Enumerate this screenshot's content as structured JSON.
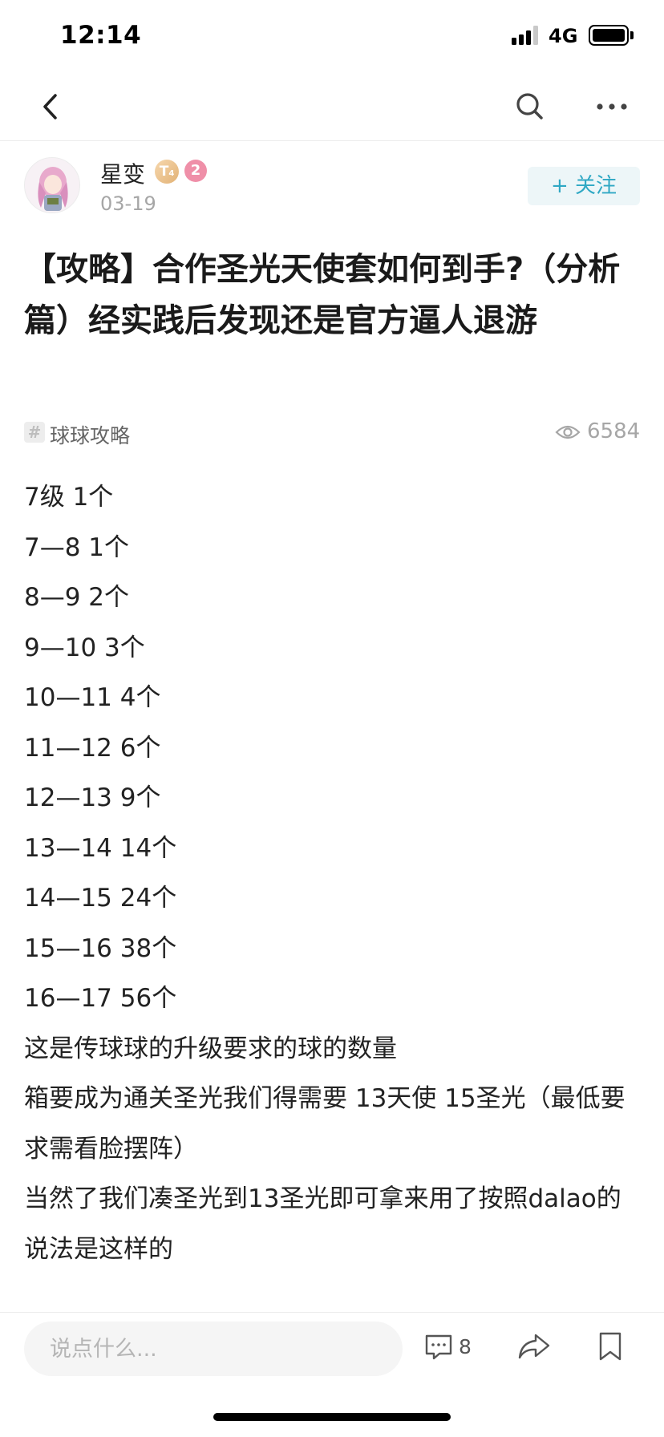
{
  "status_bar": {
    "time": "12:14",
    "network": "4G"
  },
  "nav": {
    "back_icon": "chevron-left-icon",
    "search_icon": "search-icon",
    "more_icon": "more-horizontal-icon"
  },
  "author": {
    "name": "星变",
    "badge_label": "T",
    "badge_sub": "4",
    "level": "2",
    "date": "03-19",
    "follow_label": "+ 关注"
  },
  "post": {
    "title": "【攻略】合作圣光天使套如何到手?（分析篇）经实践后发现还是官方逼人退游",
    "tag_label": "球球攻略",
    "view_count": "6584",
    "body_lines": [
      "7级 1个",
      "7—8 1个",
      "8—9 2个",
      "9—10 3个",
      "10—11 4个",
      "11—12 6个",
      "12—13 9个",
      "13—14 14个",
      "14—15 24个",
      "15—16 38个",
      "16—17 56个",
      "这是传球球的升级要求的球的数量",
      "箱要成为通关圣光我们得需要 13天使 15圣光（最低要求需看脸摆阵）",
      "当然了我们凑圣光到13圣光即可拿来用了按照dalao的说法是这样的"
    ]
  },
  "bottom_bar": {
    "comment_placeholder": "说点什么...",
    "comment_count": "8"
  },
  "colors": {
    "accent": "#2fa8c4",
    "follow_bg": "#edf6f8",
    "muted": "#a6a6a6",
    "level_badge": "#ef8fa8"
  }
}
